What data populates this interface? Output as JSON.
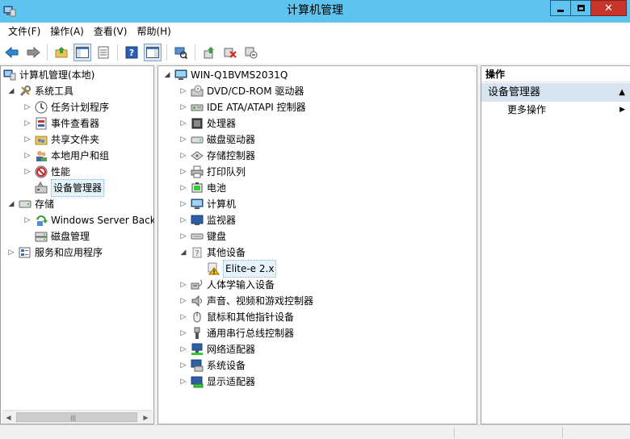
{
  "window": {
    "title": "计算机管理"
  },
  "menu": [
    "文件(F)",
    "操作(A)",
    "查看(V)",
    "帮助(H)"
  ],
  "toolbar": {
    "icons": [
      "back-icon",
      "forward-icon",
      "up-icon",
      "show-hide-tree-icon",
      "properties-icon",
      "help-icon",
      "show-hide-action-icon",
      "scan-icon",
      "update-driver-icon",
      "uninstall-icon",
      "disable-icon"
    ]
  },
  "left_tree": [
    {
      "label": "计算机管理(本地)",
      "icon": "computer-management-icon",
      "expander": "none"
    },
    {
      "label": "系统工具",
      "icon": "tools-icon",
      "expander": "expanded"
    },
    {
      "label": "任务计划程序",
      "icon": "clock-icon",
      "expander": "collapsed"
    },
    {
      "label": "事件查看器",
      "icon": "event-viewer-icon",
      "expander": "collapsed"
    },
    {
      "label": "共享文件夹",
      "icon": "shared-folder-icon",
      "expander": "collapsed"
    },
    {
      "label": "本地用户和组",
      "icon": "users-icon",
      "expander": "collapsed"
    },
    {
      "label": "性能",
      "icon": "performance-icon",
      "expander": "collapsed"
    },
    {
      "label": "设备管理器",
      "icon": "device-manager-icon",
      "expander": "none"
    },
    {
      "label": "存储",
      "icon": "storage-icon",
      "expander": "expanded"
    },
    {
      "label": "Windows Server Back",
      "icon": "backup-icon",
      "expander": "collapsed"
    },
    {
      "label": "磁盘管理",
      "icon": "disk-management-icon",
      "expander": "none"
    },
    {
      "label": "服务和应用程序",
      "icon": "services-icon",
      "expander": "collapsed"
    }
  ],
  "device_tree": {
    "root": "WIN-Q1BVMS2031Q",
    "items": [
      {
        "label": "DVD/CD-ROM 驱动器",
        "icon": "dvd-icon"
      },
      {
        "label": "IDE ATA/ATAPI 控制器",
        "icon": "ide-icon"
      },
      {
        "label": "处理器",
        "icon": "processor-icon"
      },
      {
        "label": "磁盘驱动器",
        "icon": "disk-drive-icon"
      },
      {
        "label": "存储控制器",
        "icon": "storage-controller-icon"
      },
      {
        "label": "打印队列",
        "icon": "printer-icon"
      },
      {
        "label": "电池",
        "icon": "battery-icon"
      },
      {
        "label": "计算机",
        "icon": "computer-icon"
      },
      {
        "label": "监视器",
        "icon": "monitor-icon"
      },
      {
        "label": "键盘",
        "icon": "keyboard-icon"
      },
      {
        "label": "其他设备",
        "icon": "other-devices-icon",
        "expanded": true
      },
      {
        "label": "Elite-e 2.x",
        "icon": "warning-device-icon",
        "child": true
      },
      {
        "label": "人体学输入设备",
        "icon": "hid-icon"
      },
      {
        "label": "声音、视频和游戏控制器",
        "icon": "speaker-icon"
      },
      {
        "label": "鼠标和其他指针设备",
        "icon": "mouse-icon"
      },
      {
        "label": "通用串行总线控制器",
        "icon": "usb-icon"
      },
      {
        "label": "网络适配器",
        "icon": "network-icon"
      },
      {
        "label": "系统设备",
        "icon": "system-devices-icon"
      },
      {
        "label": "显示适配器",
        "icon": "display-adapter-icon"
      }
    ]
  },
  "actions": {
    "header": "操作",
    "section": "设备管理器",
    "items": [
      "更多操作"
    ]
  },
  "colors": {
    "titlebar": "#5ec3ee",
    "close": "#c7342c",
    "action_section": "#d9e4f1",
    "selection": "#e5f3fb"
  }
}
